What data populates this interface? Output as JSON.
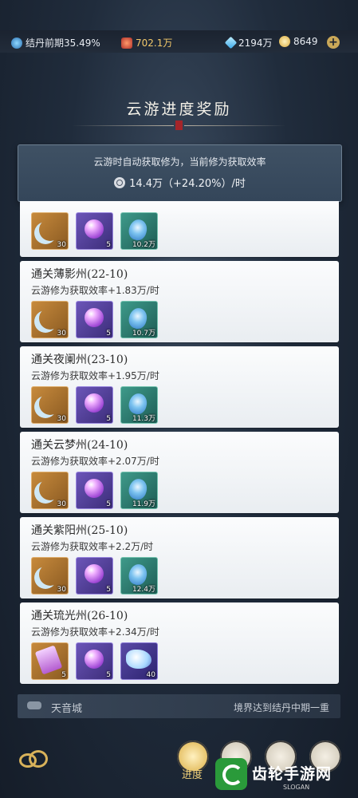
{
  "topbar": {
    "realm": "结丹前期35.49%",
    "battle": "702.1万",
    "gems": "2194万",
    "coins": "8649",
    "add_label": "+"
  },
  "title": "云游进度奖励",
  "summary": {
    "desc": "云游时自动获取修为，当前修为获取效率",
    "rate": "14.4万（+24.20%）/时"
  },
  "cards": [
    {
      "title": "",
      "effect": "",
      "items": [
        {
          "icon": "crescent-icon",
          "count": "30"
        },
        {
          "icon": "purple-orb-icon",
          "count": "5"
        },
        {
          "icon": "swirl-crystal-icon",
          "count": "10.2万"
        }
      ]
    },
    {
      "title": "通关薄影州(22-10)",
      "effect": "云游修为获取效率+1.83万/时",
      "items": [
        {
          "icon": "crescent-icon",
          "count": "30"
        },
        {
          "icon": "purple-orb-icon",
          "count": "5"
        },
        {
          "icon": "swirl-crystal-icon",
          "count": "10.7万"
        }
      ]
    },
    {
      "title": "通关夜阑州(23-10)",
      "effect": "云游修为获取效率+1.95万/时",
      "items": [
        {
          "icon": "crescent-icon",
          "count": "30"
        },
        {
          "icon": "purple-orb-icon",
          "count": "5"
        },
        {
          "icon": "swirl-crystal-icon",
          "count": "11.3万"
        }
      ]
    },
    {
      "title": "通关云梦州(24-10)",
      "effect": "云游修为获取效率+2.07万/时",
      "items": [
        {
          "icon": "crescent-icon",
          "count": "30"
        },
        {
          "icon": "purple-orb-icon",
          "count": "5"
        },
        {
          "icon": "swirl-crystal-icon",
          "count": "11.9万"
        }
      ]
    },
    {
      "title": "通关紫阳州(25-10)",
      "effect": "云游修为获取效率+2.2万/时",
      "items": [
        {
          "icon": "crescent-icon",
          "count": "30"
        },
        {
          "icon": "purple-orb-icon",
          "count": "5"
        },
        {
          "icon": "swirl-crystal-icon",
          "count": "12.4万"
        }
      ]
    },
    {
      "title": "通关琉光州(26-10)",
      "effect": "云游修为获取效率+2.34万/时",
      "items": [
        {
          "icon": "talisman-icon",
          "count": "5"
        },
        {
          "icon": "purple-orb-icon",
          "count": "5"
        },
        {
          "icon": "spirit-beast-icon",
          "count": "40"
        }
      ]
    }
  ],
  "next": {
    "city": "天音城",
    "requirement": "境界达到结丹中期一重"
  },
  "bottom_nav": {
    "active_label": "进度"
  },
  "watermark": {
    "text": "齿轮手游网",
    "sub": "SLOGAN"
  }
}
